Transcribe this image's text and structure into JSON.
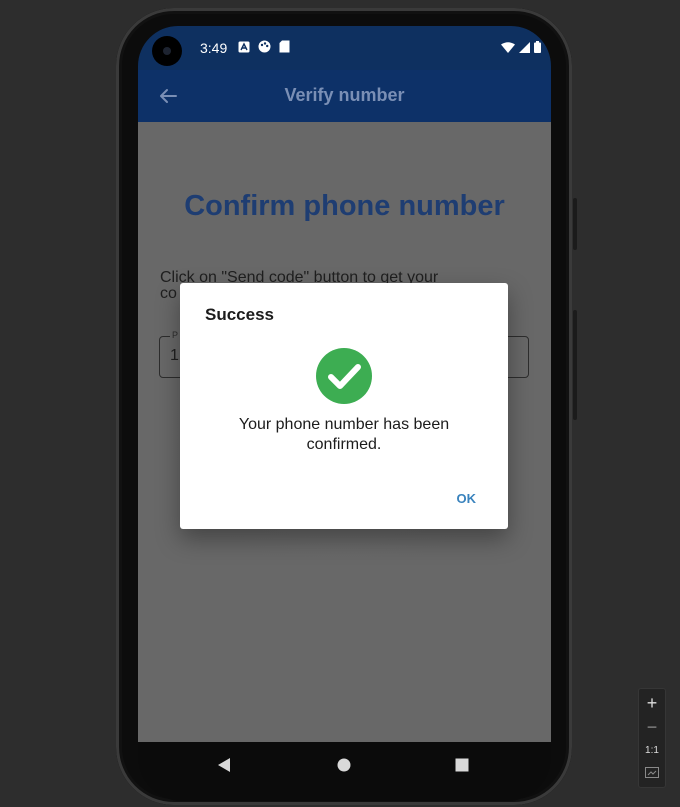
{
  "status_bar": {
    "time": "3:49",
    "icons": [
      "font-icon",
      "color-palette-icon",
      "sd-card-icon"
    ],
    "right_icons": [
      "wifi-icon",
      "signal-icon",
      "battery-icon"
    ]
  },
  "app_bar": {
    "title": "Verify number",
    "back_icon": "arrow-back-icon"
  },
  "page": {
    "heading": "Confirm phone number",
    "instructions_line1": "Click on \"Send code\" button to get your",
    "instructions_line2": "co",
    "field_label": "P",
    "field_value": "1"
  },
  "dialog": {
    "title": "Success",
    "icon": "check-circle-icon",
    "message_line1": "Your phone number has been",
    "message_line2": "confirmed.",
    "ok_label": "OK"
  },
  "nav_bar": {
    "back": "triangle-back-icon",
    "home": "circle-home-icon",
    "recents": "square-recents-icon"
  },
  "zoom_controls": {
    "zoom_in": "+",
    "zoom_out": "−",
    "actual_size": "1:1",
    "fit_icon": "fit-screen-icon"
  },
  "colors": {
    "app_bar": "#0d3168",
    "heading": "#1e3d72",
    "success_green": "#3dad52",
    "ok_blue": "#3a83bd",
    "scrim_content": "#686868"
  }
}
